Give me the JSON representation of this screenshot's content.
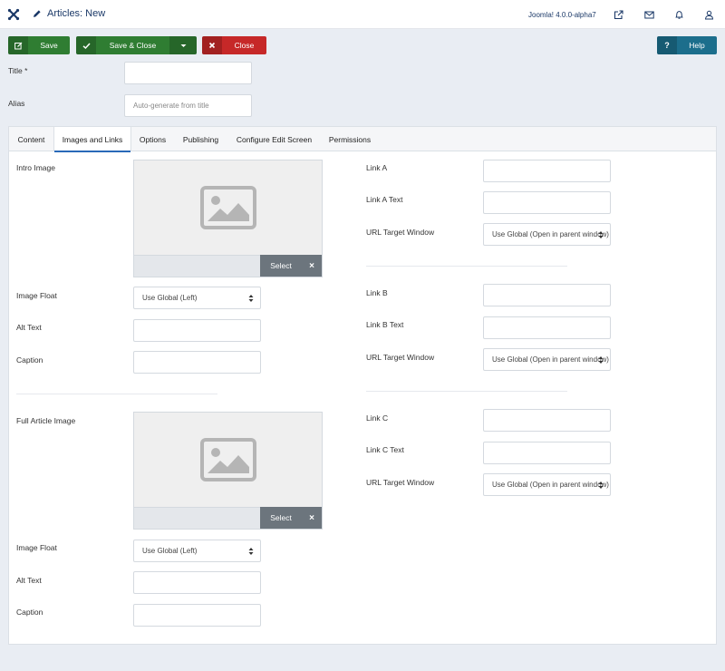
{
  "header": {
    "title": "Articles: New",
    "version": "Joomla! 4.0.0-alpha7",
    "icons": [
      "joomla-logo-icon",
      "pencil-icon",
      "external-link-icon",
      "envelope-icon",
      "bell-icon",
      "user-icon"
    ]
  },
  "toolbar": {
    "save_label": "Save",
    "save_close_label": "Save & Close",
    "close_label": "Close",
    "help_label": "Help",
    "help_icon_text": "?"
  },
  "form": {
    "title_label": "Title *",
    "title_value": "",
    "alias_label": "Alias",
    "alias_placeholder": "Auto-generate from title"
  },
  "tabs": [
    {
      "label": "Content"
    },
    {
      "label": "Images and Links"
    },
    {
      "label": "Options"
    },
    {
      "label": "Publishing"
    },
    {
      "label": "Configure Edit Screen"
    },
    {
      "label": "Permissions"
    }
  ],
  "active_tab": "Images and Links",
  "intro": {
    "label": "Intro Image",
    "select_label": "Select",
    "float_label": "Image Float",
    "float_value": "Use Global (Left)",
    "alt_label": "Alt Text",
    "caption_label": "Caption"
  },
  "full": {
    "label": "Full Article Image",
    "select_label": "Select",
    "float_label": "Image Float",
    "float_value": "Use Global (Left)",
    "alt_label": "Alt Text",
    "caption_label": "Caption"
  },
  "links": [
    {
      "link_label": "Link A",
      "text_label": "Link A Text",
      "target_label": "URL Target Window",
      "target_value": "Use Global (Open in parent window)"
    },
    {
      "link_label": "Link B",
      "text_label": "Link B Text",
      "target_label": "URL Target Window",
      "target_value": "Use Global (Open in parent window)"
    },
    {
      "link_label": "Link C",
      "text_label": "Link C Text",
      "target_label": "URL Target Window",
      "target_value": "Use Global (Open in parent window)"
    }
  ],
  "colors": {
    "success": "#2f7d32",
    "danger": "#c62828",
    "info": "#1c6e8c",
    "accent": "#2a69b8",
    "header_text": "#1a3867"
  }
}
